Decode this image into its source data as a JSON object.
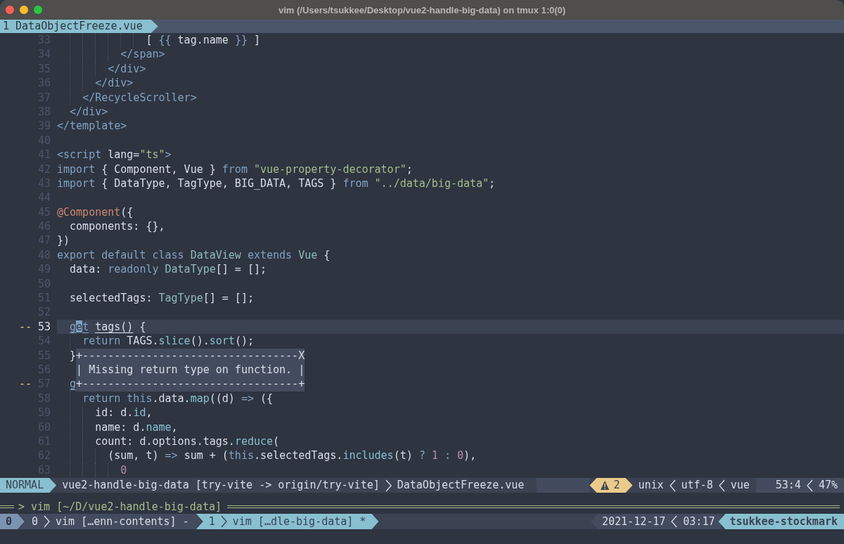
{
  "window": {
    "title": "vim (/Users/tsukkee/Desktop/vue2-handle-big-data) on tmux 1:0(0)"
  },
  "tabline": {
    "tab": "1 DataObjectFreeze.vue"
  },
  "lines": [
    {
      "number": "33",
      "tokens": [
        {
          "kind": "p",
          "text": "              [ "
        },
        {
          "kind": "k",
          "text": "{{"
        },
        {
          "kind": "p",
          "text": " tag.name "
        },
        {
          "kind": "k",
          "text": "}}"
        },
        {
          "kind": "p",
          "text": " ]"
        }
      ]
    },
    {
      "number": "34",
      "tokens": [
        {
          "kind": "k",
          "text": "          </span>"
        }
      ]
    },
    {
      "number": "35",
      "tokens": [
        {
          "kind": "k",
          "text": "        </div>"
        }
      ]
    },
    {
      "number": "36",
      "tokens": [
        {
          "kind": "k",
          "text": "      </div>"
        }
      ]
    },
    {
      "number": "37",
      "tokens": [
        {
          "kind": "k",
          "text": "    </RecycleScroller>"
        }
      ]
    },
    {
      "number": "38",
      "tokens": [
        {
          "kind": "k",
          "text": "  </div>"
        }
      ]
    },
    {
      "number": "39",
      "tokens": [
        {
          "kind": "k",
          "text": "</template>"
        }
      ]
    },
    {
      "number": "40"
    },
    {
      "number": "41",
      "tokens": [
        {
          "kind": "k",
          "text": "<script"
        },
        {
          "kind": "p",
          "text": " lang="
        },
        {
          "kind": "s",
          "text": "\"ts\""
        },
        {
          "kind": "k",
          "text": ">"
        }
      ]
    },
    {
      "number": "42",
      "tokens": [
        {
          "kind": "k",
          "text": "import"
        },
        {
          "kind": "p",
          "text": " { Component, Vue } "
        },
        {
          "kind": "k",
          "text": "from"
        },
        {
          "kind": "s",
          "text": " \"vue-property-decorator\""
        },
        {
          "kind": "p",
          "text": ";"
        }
      ]
    },
    {
      "number": "43",
      "tokens": [
        {
          "kind": "k",
          "text": "import"
        },
        {
          "kind": "p",
          "text": " { DataType, TagType, BIG_DATA, TAGS } "
        },
        {
          "kind": "k",
          "text": "from"
        },
        {
          "kind": "s",
          "text": " \"../data/big-data\""
        },
        {
          "kind": "p",
          "text": ";"
        }
      ]
    },
    {
      "number": "44"
    },
    {
      "number": "45",
      "tokens": [
        {
          "kind": "d",
          "text": "@Component"
        },
        {
          "kind": "p",
          "text": "({"
        }
      ]
    },
    {
      "number": "46",
      "tokens": [
        {
          "kind": "p",
          "text": "  components: {},"
        }
      ]
    },
    {
      "number": "47",
      "tokens": [
        {
          "kind": "p",
          "text": "})"
        }
      ]
    },
    {
      "number": "48",
      "tokens": [
        {
          "kind": "k",
          "text": "export default class"
        },
        {
          "kind": "t",
          "text": " DataView "
        },
        {
          "kind": "k",
          "text": "extends"
        },
        {
          "kind": "t",
          "text": " Vue"
        },
        {
          "kind": "p",
          "text": " {"
        }
      ]
    },
    {
      "number": "49",
      "tokens": [
        {
          "kind": "p",
          "text": "  data: "
        },
        {
          "kind": "k",
          "text": "readonly"
        },
        {
          "kind": "t",
          "text": " DataType"
        },
        {
          "kind": "p",
          "text": "[] = [];"
        }
      ]
    },
    {
      "number": "50"
    },
    {
      "number": "51",
      "tokens": [
        {
          "kind": "p",
          "text": "  selectedTags: "
        },
        {
          "kind": "t",
          "text": "TagType"
        },
        {
          "kind": "p",
          "text": "[] = [];"
        }
      ]
    },
    {
      "number": "52"
    },
    {
      "number": "53",
      "marker": "--",
      "current": true,
      "tokens": [
        {
          "kind": "k",
          "text": "  g",
          "underline": true
        },
        {
          "kind": "c",
          "text": "e",
          "underline": true
        },
        {
          "kind": "k",
          "text": "t",
          "underline": true
        },
        {
          "kind": "p",
          "text": " tags()",
          "underline": true
        },
        {
          "kind": "p",
          "text": " {"
        }
      ]
    },
    {
      "number": "54",
      "tokens": [
        {
          "kind": "k",
          "text": "    return"
        },
        {
          "kind": "p",
          "text": " TAGS."
        },
        {
          "kind": "f",
          "text": "slice"
        },
        {
          "kind": "p",
          "text": "()."
        },
        {
          "kind": "f",
          "text": "sort"
        },
        {
          "kind": "p",
          "text": "();"
        }
      ]
    },
    {
      "number": "55",
      "tokens": [
        {
          "kind": "p",
          "text": "  }"
        }
      ],
      "popup": [
        "+----------------------------------X",
        "| Missing return type on function. |",
        "+----------------------------------+"
      ]
    },
    {
      "number": "56"
    },
    {
      "number": "57",
      "marker": "--",
      "tokens": [
        {
          "kind": "k",
          "text": "  g",
          "underline": true
        }
      ]
    },
    {
      "number": "58",
      "tokens": [
        {
          "kind": "k",
          "text": "    return this"
        },
        {
          "kind": "p",
          "text": ".data."
        },
        {
          "kind": "f",
          "text": "map"
        },
        {
          "kind": "p",
          "text": "((d) "
        },
        {
          "kind": "k",
          "text": "=>"
        },
        {
          "kind": "p",
          "text": " ({"
        }
      ]
    },
    {
      "number": "59",
      "tokens": [
        {
          "kind": "p",
          "text": "      id: d."
        },
        {
          "kind": "f",
          "text": "id"
        },
        {
          "kind": "p",
          "text": ","
        }
      ]
    },
    {
      "number": "60",
      "tokens": [
        {
          "kind": "p",
          "text": "      name: d."
        },
        {
          "kind": "f",
          "text": "name"
        },
        {
          "kind": "p",
          "text": ","
        }
      ]
    },
    {
      "number": "61",
      "tokens": [
        {
          "kind": "p",
          "text": "      count: d.options.tags."
        },
        {
          "kind": "f",
          "text": "reduce"
        },
        {
          "kind": "p",
          "text": "("
        }
      ]
    },
    {
      "number": "62",
      "tokens": [
        {
          "kind": "p",
          "text": "        (sum, t) "
        },
        {
          "kind": "k",
          "text": "=>"
        },
        {
          "kind": "p",
          "text": " sum + ("
        },
        {
          "kind": "k",
          "text": "this"
        },
        {
          "kind": "p",
          "text": ".selectedTags."
        },
        {
          "kind": "f",
          "text": "includes"
        },
        {
          "kind": "p",
          "text": "(t) "
        },
        {
          "kind": "k",
          "text": "? "
        },
        {
          "kind": "n",
          "text": "1 "
        },
        {
          "kind": "k",
          "text": ": "
        },
        {
          "kind": "n",
          "text": "0"
        },
        {
          "kind": "p",
          "text": "),"
        }
      ]
    },
    {
      "number": "63",
      "tokens": [
        {
          "kind": "n",
          "text": "          0"
        }
      ]
    }
  ],
  "statusline": {
    "mode": "NORMAL",
    "project": "vue2-handle-big-data [try-vite -> origin/try-vite]",
    "file": "DataObjectFreeze.vue",
    "warnings": "2",
    "fileformat": "unix",
    "encoding": "utf-8",
    "filetype": "vue",
    "position": "53:4",
    "percent": "47%"
  },
  "tmux": {
    "pane_title": "> vim [~/D/vue2-handle-big-data]",
    "session": "0",
    "windows": [
      {
        "index": "0",
        "name": "vim […enn-contents] -",
        "selected": false
      },
      {
        "index": "1",
        "name": "vim […dle-big-data] *",
        "selected": true
      }
    ],
    "date": "2021-12-17",
    "time": "03:17",
    "host": "tsukkee-stockmark"
  }
}
